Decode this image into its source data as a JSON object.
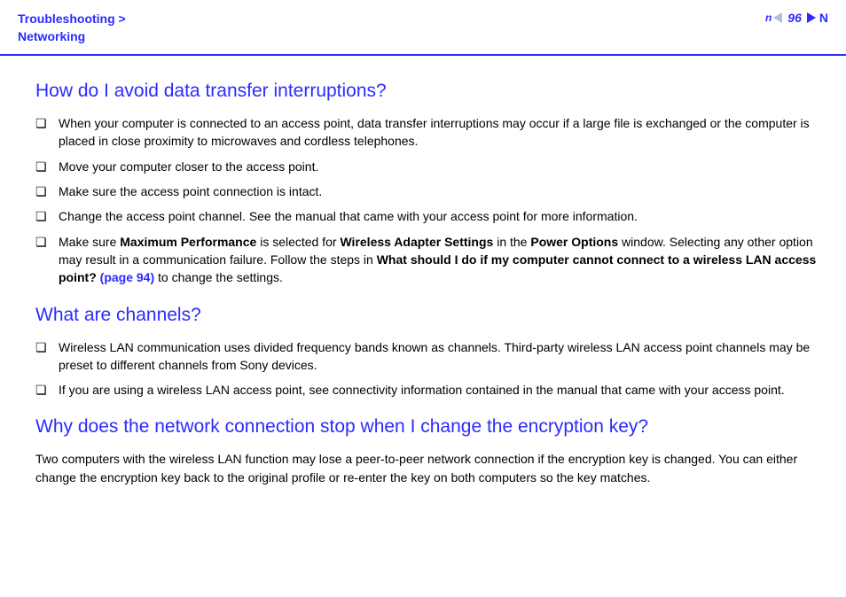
{
  "header": {
    "breadcrumb_line1": "Troubleshooting >",
    "breadcrumb_line2": "Networking",
    "page_number": "96",
    "n_label": "n",
    "big_n": "N"
  },
  "section1": {
    "title": "How do I avoid data transfer interruptions?",
    "items": [
      "When your computer is connected to an access point, data transfer interruptions may occur if a large file is exchanged or the computer is placed in close proximity to microwaves and cordless telephones.",
      "Move your computer closer to the access point.",
      "Make sure the access point connection is intact.",
      "Change the access point channel. See the manual that came with your access point for more information."
    ],
    "item5_pre": "Make sure ",
    "item5_b1": "Maximum Performance",
    "item5_mid1": " is selected for ",
    "item5_b2": "Wireless Adapter Settings",
    "item5_mid2": " in the ",
    "item5_b3": "Power Options",
    "item5_mid3": " window. Selecting any other option may result in a communication failure. Follow the steps in ",
    "item5_b4": "What should I do if my computer cannot connect to a wireless LAN access point? ",
    "item5_link": "(page 94)",
    "item5_post": " to change the settings."
  },
  "section2": {
    "title": "What are channels?",
    "items": [
      "Wireless LAN communication uses divided frequency bands known as channels. Third-party wireless LAN access point channels may be preset to different channels from Sony devices.",
      "If you are using a wireless LAN access point, see connectivity information contained in the manual that came with your access point."
    ]
  },
  "section3": {
    "title": "Why does the network connection stop when I change the encryption key?",
    "paragraph": "Two computers with the wireless LAN function may lose a peer-to-peer network connection if the encryption key is changed. You can either change the encryption key back to the original profile or re-enter the key on both computers so the key matches."
  }
}
